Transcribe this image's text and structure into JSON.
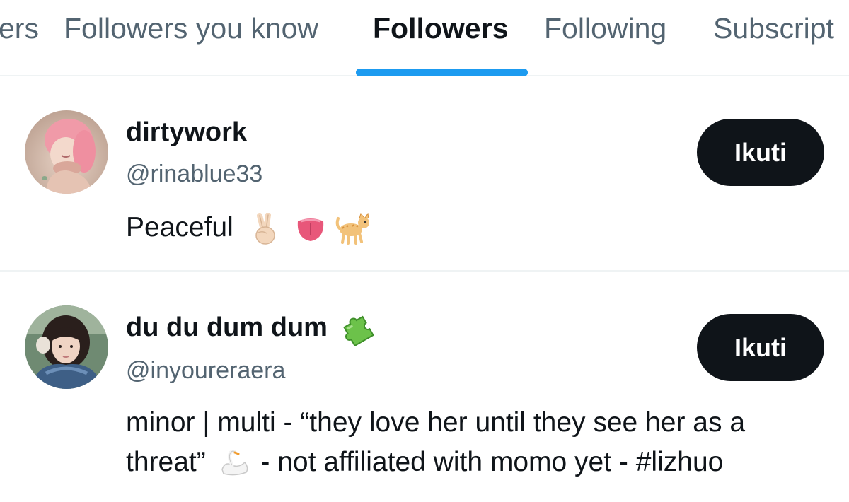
{
  "tabs": [
    {
      "label": "ers",
      "active": false
    },
    {
      "label": "Followers you know",
      "active": false
    },
    {
      "label": "Followers",
      "active": true
    },
    {
      "label": "Following",
      "active": false
    },
    {
      "label": "Subscript",
      "active": false
    }
  ],
  "users": [
    {
      "display_name": "dirtywork",
      "handle": "@rinablue33",
      "bio_text": "Peaceful",
      "bio_emojis": [
        "victory-hand-icon",
        "tongue-icon",
        "cat-icon"
      ],
      "follow_label": "Ikuti"
    },
    {
      "display_name": "du du dum dum",
      "name_emoji": "puzzle-piece-icon",
      "handle": "@inyoureraera",
      "bio_line1": "minor | multi - “they love her until they see her as a",
      "bio_line2_a": "threat”",
      "bio_line2_emoji": "swan-icon",
      "bio_line2_b": " - not affiliated with momo yet - #lizhuo",
      "follow_label": "Ikuti"
    }
  ],
  "colors": {
    "accent": "#1d9bf0",
    "text_primary": "#0f1419",
    "text_secondary": "#536471",
    "divider": "#eff3f4",
    "button_bg": "#0f1419"
  }
}
